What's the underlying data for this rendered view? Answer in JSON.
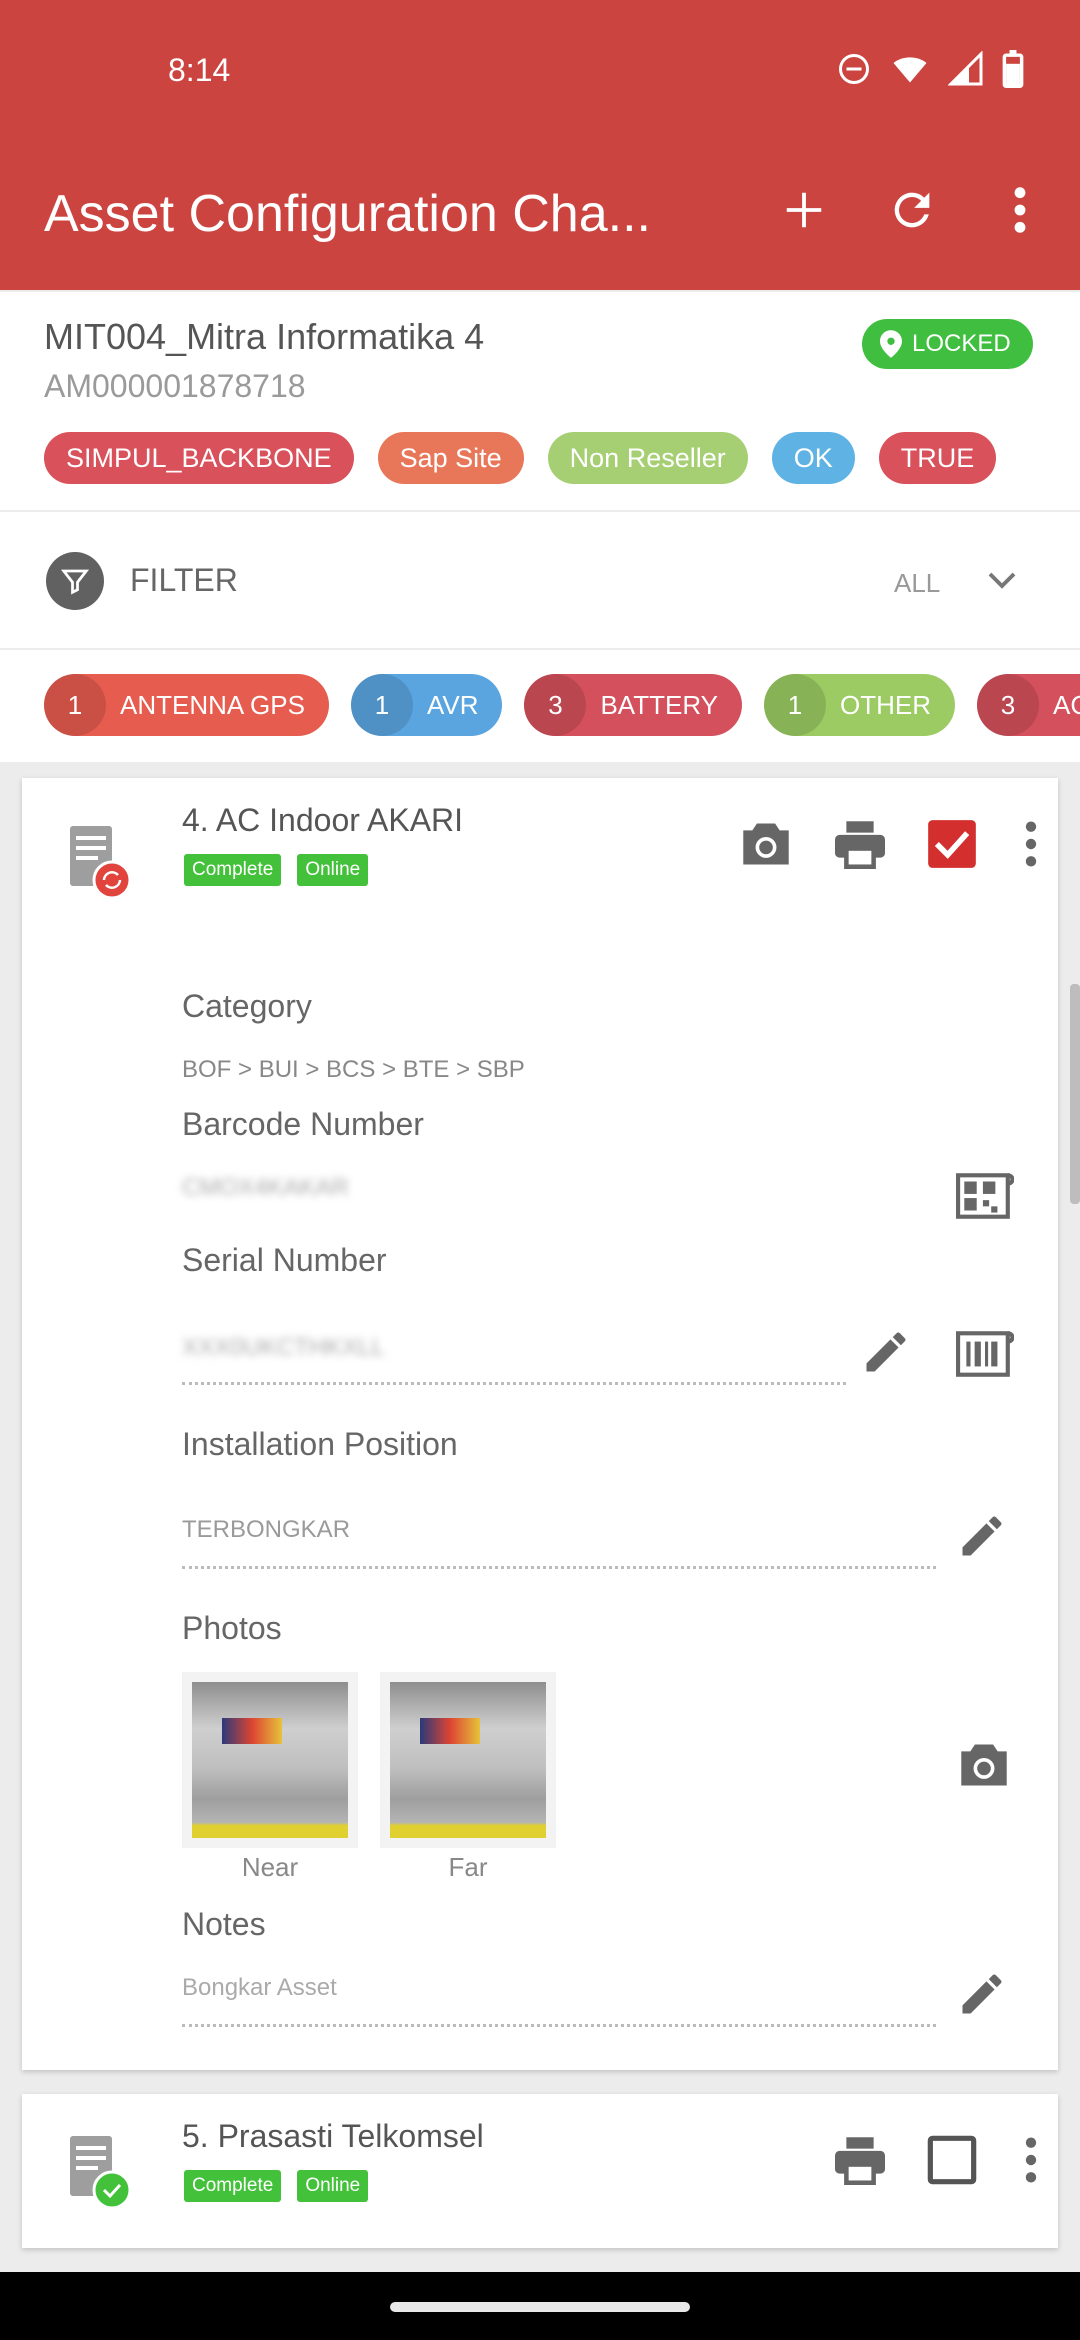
{
  "status": {
    "time": "8:14"
  },
  "appbar": {
    "title": "Asset Configuration Cha..."
  },
  "site": {
    "name": "MIT004_Mitra Informatika 4",
    "code": "AM000001878718",
    "locked_label": "LOCKED",
    "tags": [
      {
        "label": "SIMPUL_BACKBONE",
        "color": "#d9515b"
      },
      {
        "label": "Sap Site",
        "color": "#e8775a"
      },
      {
        "label": "Non Reseller",
        "color": "#a5cf72"
      },
      {
        "label": "OK",
        "color": "#5eb3e4"
      },
      {
        "label": "TRUE",
        "color": "#d9515b"
      }
    ]
  },
  "filter": {
    "label": "FILTER",
    "value": "ALL"
  },
  "chips": [
    {
      "count": "1",
      "label": "ANTENNA GPS",
      "color": "#e65c4f"
    },
    {
      "count": "1",
      "label": "AVR",
      "color": "#5aa5e0"
    },
    {
      "count": "3",
      "label": "BATTERY",
      "color": "#d4505c"
    },
    {
      "count": "1",
      "label": "OTHER",
      "color": "#9bcb62"
    },
    {
      "count": "3",
      "label": "AC IN",
      "color": "#d4505c"
    }
  ],
  "asset1": {
    "title": "4. AC Indoor AKARI",
    "badge_complete": "Complete",
    "badge_online": "Online",
    "category_label": "Category",
    "category_value": "BOF > BUI > BCS > BTE > SBP",
    "barcode_label": "Barcode Number",
    "barcode_value": "CMOX4KAKAR",
    "serial_label": "Serial Number",
    "serial_value": "XXX0UKCTHKXLL",
    "installation_label": "Installation Position",
    "installation_value": "TERBONGKAR",
    "photos_label": "Photos",
    "photo_near": "Near",
    "photo_far": "Far",
    "notes_label": "Notes",
    "notes_value": "Bongkar Asset"
  },
  "asset2": {
    "title": "5. Prasasti Telkomsel",
    "badge_complete": "Complete",
    "badge_online": "Online"
  },
  "colors": {
    "appbar": "#cc4440",
    "locked": "#3fbe3f",
    "badge": "#43c13a",
    "checkbox": "#d32f2f"
  }
}
